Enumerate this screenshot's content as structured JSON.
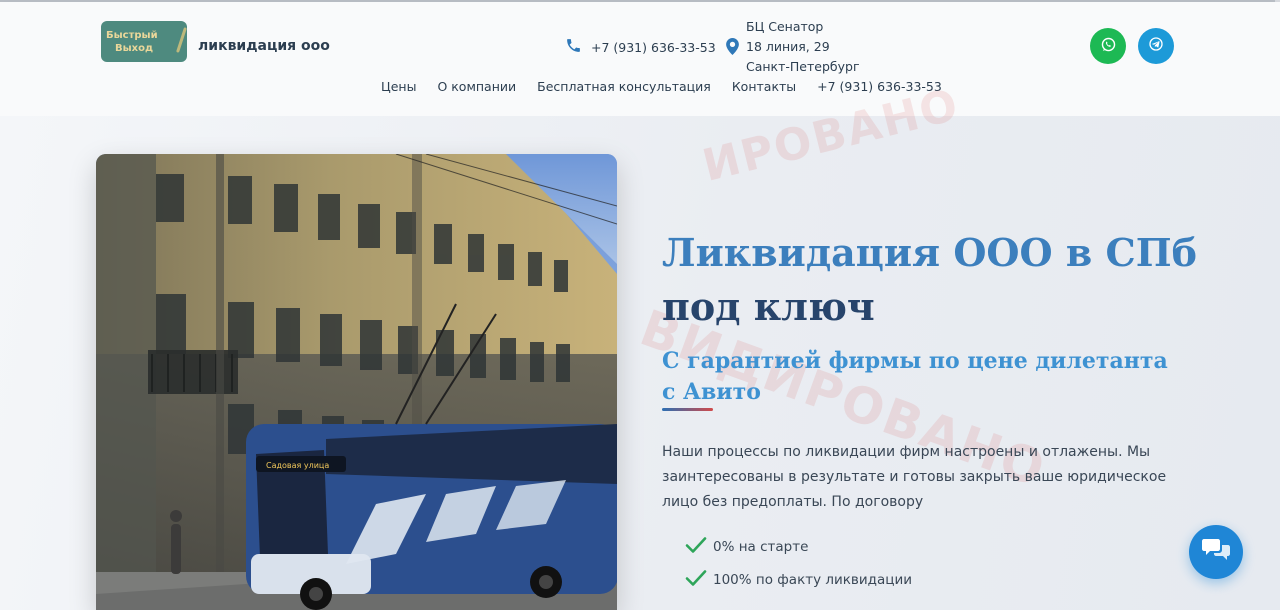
{
  "header": {
    "logo_line1": "Быстрый",
    "logo_line2": "Выход",
    "brand": "ликвидация ооо",
    "phone": "+7 (931) 636-33-53",
    "address": [
      "БЦ Сенатор",
      "18 линия, 29",
      "Санкт-Петербург"
    ],
    "social": [
      {
        "name": "whatsapp",
        "icon": "whatsapp-icon",
        "color": "#1db954"
      },
      {
        "name": "telegram",
        "icon": "telegram-icon",
        "color": "#1d9ad8"
      }
    ]
  },
  "nav": {
    "items": [
      {
        "label": "Цены"
      },
      {
        "label": "О компании"
      },
      {
        "label": "Бесплатная консультация"
      },
      {
        "label": "Контакты"
      },
      {
        "label": "+7 (931) 636-33-53"
      }
    ]
  },
  "hero": {
    "title_part1": "Ликвидация ООО в СПб",
    "title_part2": "под ключ",
    "subtitle": "С гарантией фирмы по цене дилетанта с Авито",
    "description": "Наши процессы по ликвидации фирм настроены и отлажены. Мы заинтересованы в результате и готовы закрыть ваше юридическое лицо без предоплаты. По договору",
    "checklist": [
      {
        "text": "0% на старте"
      },
      {
        "text": "100% по факту ликвидации"
      }
    ],
    "photo_sign": "Садовая улица"
  },
  "watermark": {
    "text1": "ИРОВАНО",
    "text2": "ВИДИРОВАНО"
  },
  "colors": {
    "title_blue": "#3c7fbd",
    "title_dark": "#27446b",
    "subtitle": "#3e92d2",
    "check": "#2ea55a",
    "chat_button": "#1f86d6"
  }
}
